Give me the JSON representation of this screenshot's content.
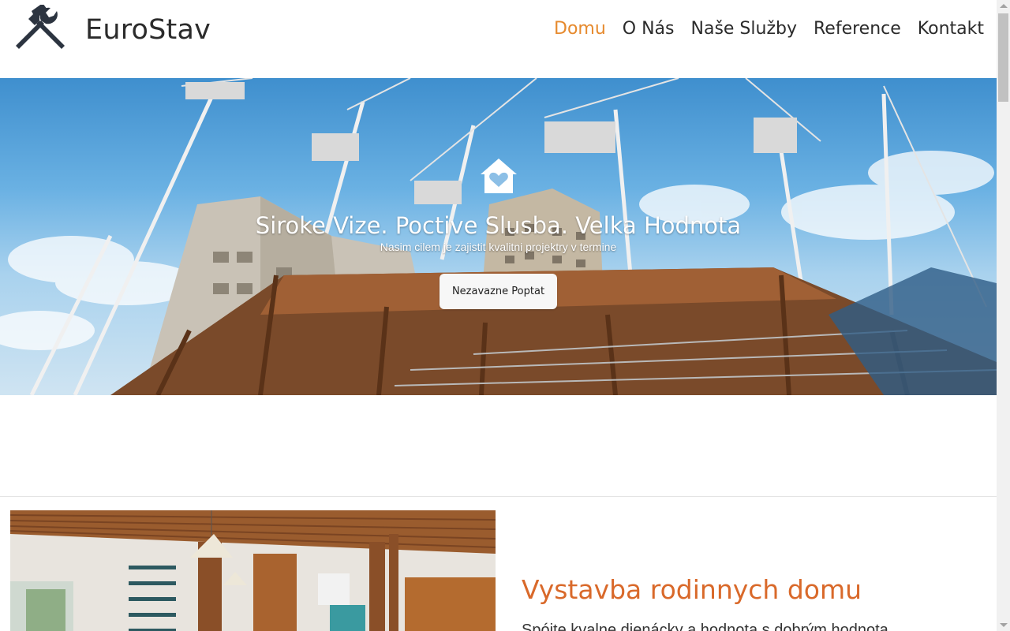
{
  "header": {
    "brand_name": "EuroStav",
    "brand_icon": "hammer-wrench-icon",
    "nav": [
      {
        "label": "Domu",
        "active": true
      },
      {
        "label": "O Nás",
        "active": false
      },
      {
        "label": "Naše Služby",
        "active": false
      },
      {
        "label": "Reference",
        "active": false
      },
      {
        "label": "Kontakt",
        "active": false
      }
    ],
    "active_color": "#e68a2e"
  },
  "hero": {
    "icon": "house-heart-icon",
    "title": "Siroke Vize. Poctive Slusba. Velka Hodnota",
    "subtitle": "Nasim cilem je zajistit kvalitni projektry v termine",
    "button_label": "Nezavazne Poptat"
  },
  "feature": {
    "title": "Vystavba rodinnych domu",
    "text": "Spójte kvalne dienácky a hodnota s dobrým hodnota...",
    "title_color": "#d9692a"
  }
}
